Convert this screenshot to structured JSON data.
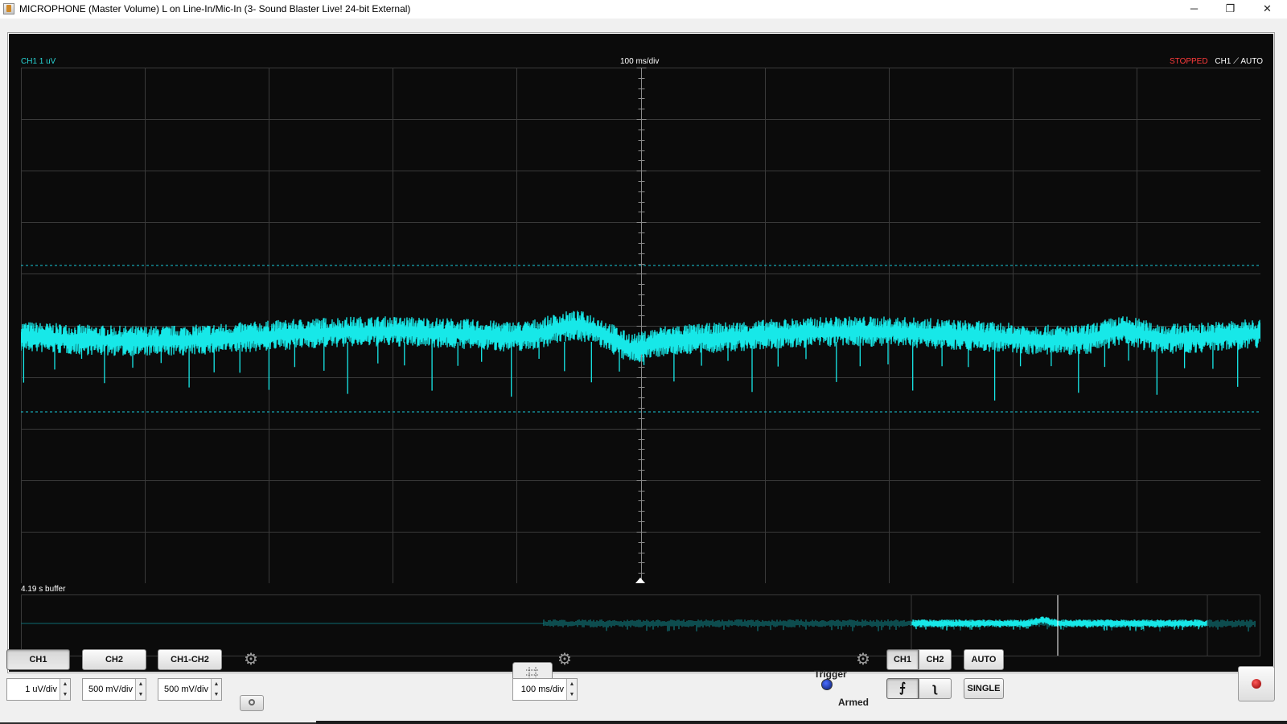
{
  "window": {
    "title": "MICROPHONE (Master Volume) L on Line-In/Mic-In (3- Sound Blaster Live! 24-bit External)",
    "minimize_glyph": "─",
    "maximize_glyph": "❐",
    "close_glyph": "✕"
  },
  "scope": {
    "channel_scale": "CH1 1 uV",
    "timebase": "100 ms/div",
    "status": "STOPPED",
    "trigger_channel": "CH1",
    "trigger_slope_glyph": "⟋",
    "trigger_mode": "AUTO",
    "buffer_label": "4.19 s buffer",
    "colors": {
      "trace": "#17e8e8",
      "grid": "#3a3a3a",
      "background": "#0b0b0b",
      "stopped": "#ff3b3b"
    }
  },
  "controls": {
    "channel_buttons": [
      "CH1",
      "CH2",
      "CH1-CH2"
    ],
    "ch1_vdiv": "1 uV/div",
    "ch2_vdiv": "500 mV/div",
    "diff_vdiv": "500 mV/div",
    "timebase_value": "100 ms/div",
    "trigger_label": "Trigger",
    "trigger_ch1": "CH1",
    "trigger_ch2": "CH2",
    "auto_button": "AUTO",
    "single_button": "SINGLE",
    "armed_label": "Armed"
  }
}
